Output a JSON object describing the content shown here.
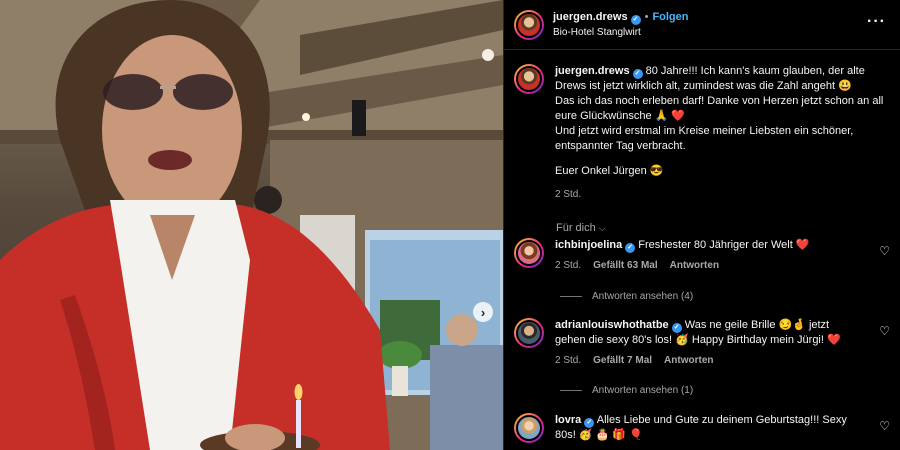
{
  "post": {
    "username": "juergen.drews",
    "verified_glyph": "✓",
    "separator": "•",
    "follow_label": "Folgen",
    "location": "Bio-Hotel Stanglwirt",
    "more_glyph": "···",
    "caption_lines": [
      "80 Jahre!!! Ich kann's kaum glauben, der alte Drews ist jetzt wirklich alt, zumindest was die Zahl angeht 😃",
      "Das ich das noch erleben darf! Danke von Herzen jetzt schon an all eure Glückwünsche 🙏 ❤️",
      "Und jetzt wird erstmal im Kreise meiner Liebsten ein schöner, entspannter Tag verbracht.",
      "Euer Onkel Jürgen 😎"
    ],
    "time": "2 Std.",
    "for_you_label": "Für dich",
    "chevron_glyph": "⌵"
  },
  "comments": [
    {
      "username": "ichbinjoelina",
      "text": "Freshester 80 Jähriger der Welt ❤️",
      "time": "2 Std.",
      "likes": "Gefällt 63 Mal",
      "reply_label": "Antworten",
      "view_replies": "Antworten ansehen (4)"
    },
    {
      "username": "adrianlouiswhothatbe",
      "text": "Was ne geile Brille 😏🤞 jetzt gehen die sexy 80's los! 🥳 Happy Birthday mein Jürgi! ❤️",
      "time": "2 Std.",
      "likes": "Gefällt 7 Mal",
      "reply_label": "Antworten",
      "view_replies": "Antworten ansehen (1)"
    },
    {
      "username": "lovra",
      "text": "Alles Liebe und Gute zu deinem Geburtstag!!! Sexy 80s! 🥳 🎂 🎁 🎈"
    }
  ],
  "icons": {
    "heart": "♡",
    "next_arrow": "›"
  },
  "colors": {
    "background": "#000000",
    "accent": "#4cb5f9",
    "verified": "#3897f0",
    "muted": "#a8a8a8",
    "jacket": "#c62f28"
  }
}
